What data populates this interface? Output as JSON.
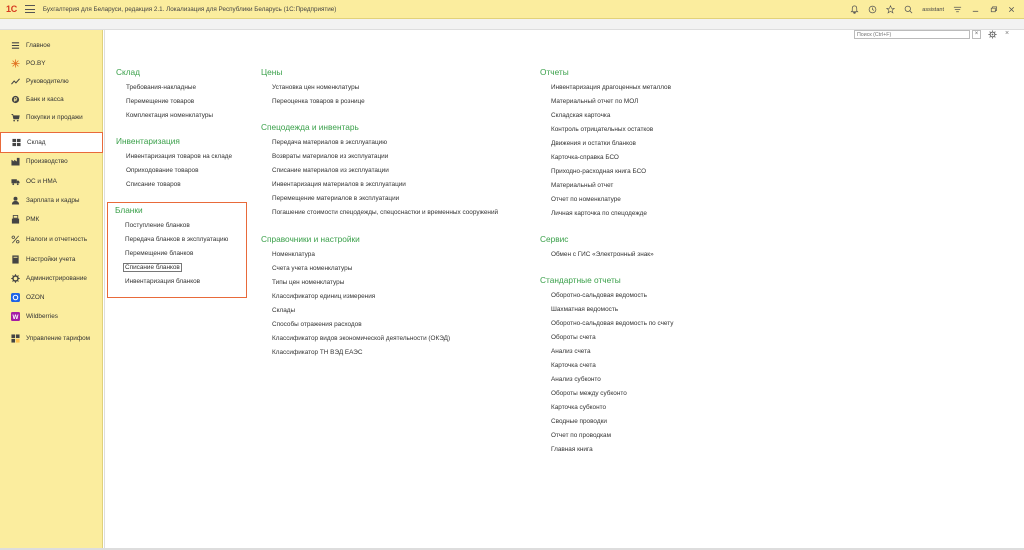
{
  "titlebar": {
    "logo": "1С",
    "title": "Бухгалтерия для Беларуси, редакция 2.1. Локализация для Республики Беларусь   (1С:Предприятие)",
    "user": "assistant"
  },
  "sidebar": {
    "items": [
      {
        "label": "Главное",
        "icon": "list-icon"
      },
      {
        "label": "PO.BY",
        "icon": "po-by-icon"
      },
      {
        "label": "Руководителю",
        "icon": "chart-icon"
      },
      {
        "label": "Банк и касса",
        "icon": "bank-icon"
      },
      {
        "label": "Покупки и продажи",
        "icon": "cart-icon"
      },
      {
        "label": "Склад",
        "icon": "warehouse-icon"
      },
      {
        "label": "Производство",
        "icon": "factory-icon"
      },
      {
        "label": "ОС и НМА",
        "icon": "truck-icon"
      },
      {
        "label": "Зарплата и кадры",
        "icon": "person-icon"
      },
      {
        "label": "РМК",
        "icon": "cash-register-icon"
      },
      {
        "label": "Налоги и отчетность",
        "icon": "percent-icon"
      },
      {
        "label": "Настройки учета",
        "icon": "book-icon"
      },
      {
        "label": "Администрирование",
        "icon": "gear-icon"
      },
      {
        "label": "OZON",
        "icon": "ozon-icon"
      },
      {
        "label": "Wildberries",
        "icon": "wildberries-icon"
      },
      {
        "label": "Управление тарифом",
        "icon": "tariff-icon"
      }
    ]
  },
  "search": {
    "placeholder": "Поиск (Ctrl+F)",
    "clear": "×"
  },
  "main": {
    "sklad": {
      "title": "Склад",
      "links": [
        "Требования-накладные",
        "Перемещение товаров",
        "Комплектация номенклатуры"
      ]
    },
    "inventarizaciya": {
      "title": "Инвентаризация",
      "links": [
        "Инвентаризация товаров на складе",
        "Оприходование товаров",
        "Списание товаров"
      ]
    },
    "blanki": {
      "title": "Бланки",
      "links": [
        "Поступление бланков",
        "Передача бланков в эксплуатацию",
        "Перемещение бланков",
        "Списание бланков",
        "Инвентаризация бланков"
      ]
    },
    "ceny": {
      "title": "Цены",
      "links": [
        "Установка цен номенклатуры",
        "Переоценка товаров в рознице"
      ]
    },
    "specodezhda": {
      "title": "Спецодежда и инвентарь",
      "links": [
        "Передача материалов в эксплуатацию",
        "Возвраты материалов из эксплуатации",
        "Списание материалов из эксплуатации",
        "Инвентаризация материалов в эксплуатации",
        "Перемещение материалов в эксплуатации",
        "Погашение стоимости спецодежды, спецоснастки и временных сооружений"
      ]
    },
    "spravochniki": {
      "title": "Справочники и настройки",
      "links": [
        "Номенклатура",
        "Счета учета номенклатуры",
        "Типы цен номенклатуры",
        "Классификатор единиц измерения",
        "Склады",
        "Способы отражения расходов",
        "Классификатор видов экономической деятельности (ОКЭД)",
        "Классификатор ТН ВЭД ЕАЭС"
      ]
    },
    "otchety": {
      "title": "Отчеты",
      "links": [
        "Инвентаризация драгоценных металлов",
        "Материальный отчет по МОЛ",
        "Складская карточка",
        "Контроль отрицательных остатков",
        "Движения и остатки бланков",
        "Карточка-справка БСО",
        "Приходно-расходная книга БСО",
        "Материальный отчет",
        "Отчет по номенклатуре",
        "Личная карточка по спецодежде"
      ]
    },
    "servis": {
      "title": "Сервис",
      "links": [
        "Обмен с ГИС «Электронный знак»"
      ]
    },
    "standartnye": {
      "title": "Стандартные отчеты",
      "links": [
        "Оборотно-сальдовая ведомость",
        "Шахматная ведомость",
        "Оборотно-сальдовая ведомость по счету",
        "Обороты счета",
        "Анализ счета",
        "Карточка счета",
        "Анализ субконто",
        "Обороты между субконто",
        "Карточка субконто",
        "Сводные проводки",
        "Отчет по проводкам",
        "Главная книга"
      ]
    }
  }
}
